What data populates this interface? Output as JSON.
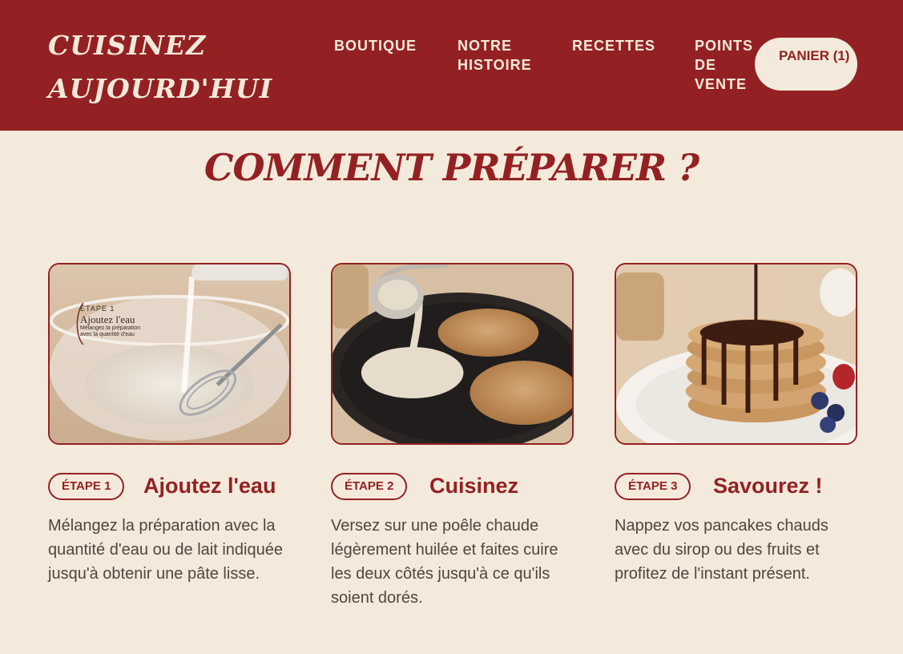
{
  "header": {
    "logo": "CUISINEZ AUJOURD'HUI",
    "nav": [
      "BOUTIQUE",
      "NOTRE HISTOIRE",
      "RECETTES",
      "POINTS DE VENTE"
    ],
    "cart_label": "PANIER (1)"
  },
  "main": {
    "title": "COMMENT PRÉPARER ?",
    "steps": [
      {
        "badge": "ÉTAPE 1",
        "title": "Ajoutez l'eau",
        "description": "Mélangez la préparation avec la quantité d'eau ou de lait indiquée jusqu'à obtenir une pâte lisse.",
        "photo_overlay": {
          "label": "ÉTAPE 1",
          "title": "Ajoutez l'eau",
          "description": "Mélangez la préparation avec la quantité d'eau"
        }
      },
      {
        "badge": "ÉTAPE 2",
        "title": "Cuisinez",
        "description": "Versez sur une poêle chaude légèrement huilée et faites cuire les deux côtés jusqu'à ce qu'ils soient dorés."
      },
      {
        "badge": "ÉTAPE 3",
        "title": "Savourez !",
        "description": "Nappez vos pancakes chauds avec du sirop ou des fruits et profitez de l'instant présent."
      }
    ]
  },
  "colors": {
    "brand_red": "#932123",
    "cream": "#f3eadb",
    "text": "#4f463f"
  }
}
